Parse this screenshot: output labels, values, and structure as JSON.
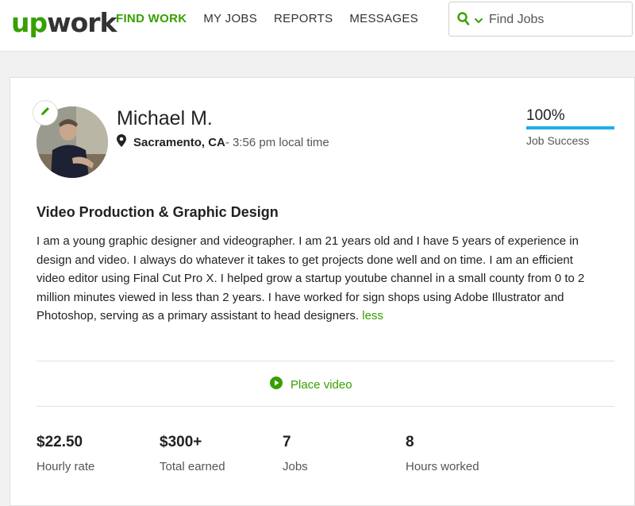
{
  "header": {
    "logo_up": "up",
    "logo_work": "work",
    "nav": [
      "FIND WORK",
      "MY JOBS",
      "REPORTS",
      "MESSAGES"
    ],
    "search_placeholder": "Find Jobs"
  },
  "profile": {
    "name": "Michael M.",
    "city": "Sacramento, CA",
    "time": " - 3:56 pm local time",
    "job_success_pct": "100%",
    "job_success_value": 100,
    "job_success_label": "Job Success",
    "title": "Video Production & Graphic Design",
    "description": "I am a young graphic designer and videographer. I am 21 years old and I have 5 years of experience in design and video. I always do whatever it takes to get projects done well and on time. I am an efficient video editor using Final Cut Pro X. I helped grow a startup youtube channel in a small county from 0 to 2 million minutes viewed in less than 2 years. I have worked for sign shops using Adobe Illustrator and Photoshop, serving as a primary assistant to head designers.",
    "less_link": "less",
    "place_video": "Place video"
  },
  "stats": [
    {
      "value": "$22.50",
      "label": "Hourly rate"
    },
    {
      "value": "$300+",
      "label": "Total earned"
    },
    {
      "value": "7",
      "label": "Jobs"
    },
    {
      "value": "8",
      "label": "Hours worked"
    }
  ],
  "colors": {
    "brand_green": "#37a000",
    "progress_blue": "#1eaee8"
  }
}
